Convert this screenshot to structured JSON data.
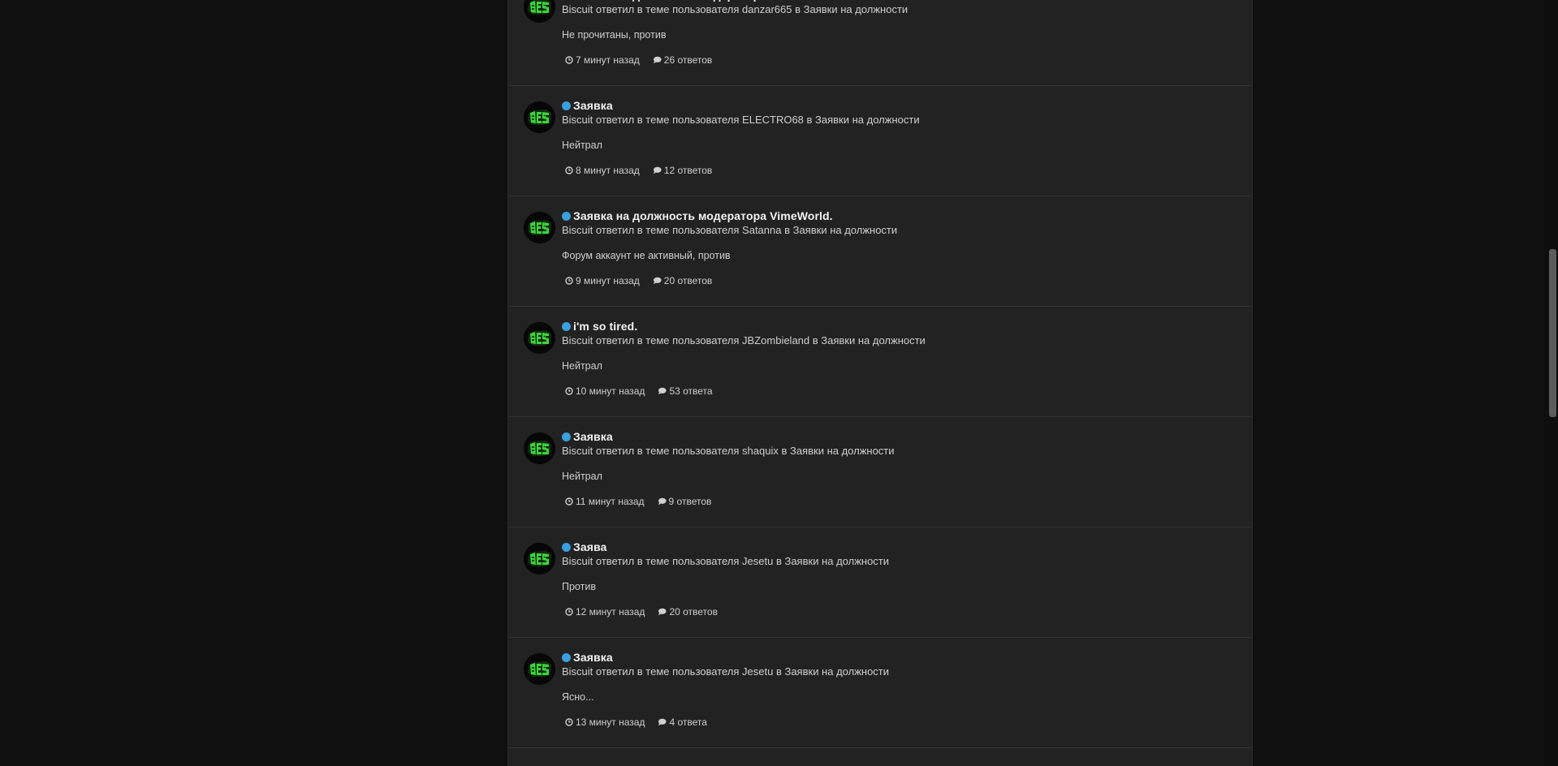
{
  "posts": [
    {
      "title": "Заявка на должность модератора VimeWorld.",
      "meta": "Biscuit ответил в теме пользователя danzar665 в Заявки на должности",
      "snippet": "Не прочитаны, против",
      "time": "7 минут назад",
      "replies": "26 ответов"
    },
    {
      "title": "Заявка",
      "meta": "Biscuit ответил в теме пользователя ELECTRO68 в Заявки на должности",
      "snippet": "Нейтрал",
      "time": "8 минут назад",
      "replies": "12 ответов"
    },
    {
      "title": "Заявка на должность модератора VimeWorld.",
      "meta": "Biscuit ответил в теме пользователя Satanna в Заявки на должности",
      "snippet": "Форум аккаунт не активный, против",
      "time": "9 минут назад",
      "replies": "20 ответов"
    },
    {
      "title": "i'm so tired.",
      "meta": "Biscuit ответил в теме пользователя JBZombieland в Заявки на должности",
      "snippet": "Нейтрал",
      "time": "10 минут назад",
      "replies": "53 ответа"
    },
    {
      "title": "Заявка",
      "meta": "Biscuit ответил в теме пользователя shaquix в Заявки на должности",
      "snippet": "Нейтрал",
      "time": "11 минут назад",
      "replies": "9 ответов"
    },
    {
      "title": "Заява",
      "meta": "Biscuit ответил в теме пользователя Jesetu в Заявки на должности",
      "snippet": "Против",
      "time": "12 минут назад",
      "replies": "20 ответов"
    },
    {
      "title": "Заявка",
      "meta": "Biscuit ответил в теме пользователя Jesetu в Заявки на должности",
      "snippet": "Ясно...",
      "time": "13 минут назад",
      "replies": "4 ответа"
    }
  ],
  "icons": {
    "avatar": "user-avatar",
    "unread": "unread-dot-icon",
    "time": "clock-icon",
    "replies": "comment-icon"
  },
  "colors": {
    "background": "#101010",
    "feed_background": "#222222",
    "unread_dot": "#3a9fdc",
    "avatar_logo": "#39d63a"
  }
}
